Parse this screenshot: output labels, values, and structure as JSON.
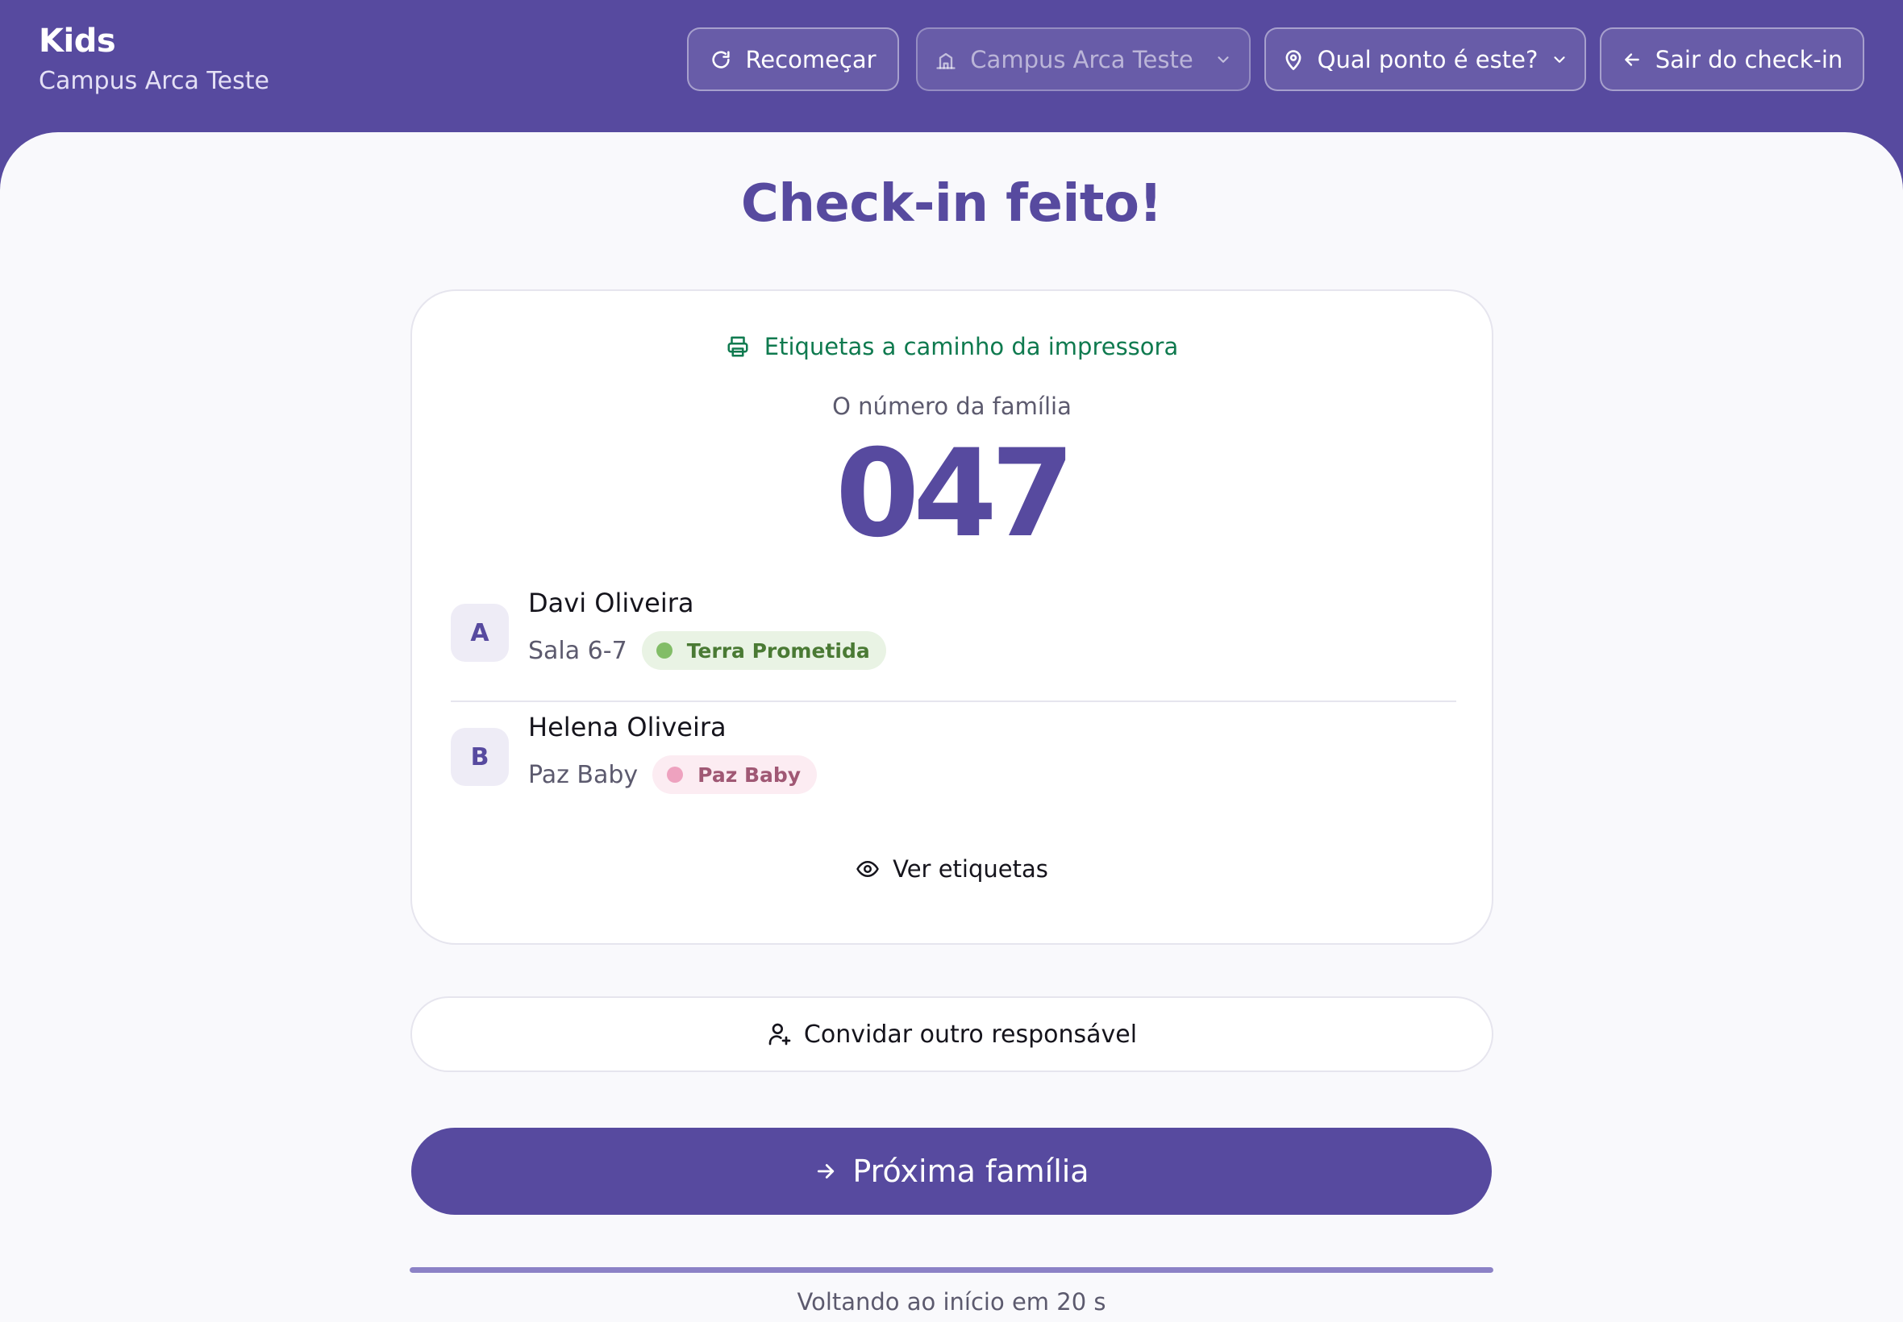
{
  "header": {
    "app_title": "Kids",
    "campus_subtitle": "Campus Arca Teste",
    "buttons": {
      "restart": {
        "label": "Recomeçar",
        "icon": "refresh-icon"
      },
      "campus": {
        "label": "Campus Arca Teste",
        "icon": "building-icon",
        "disabled": true
      },
      "point": {
        "label": "Qual ponto é este?",
        "icon": "map-pin-icon"
      },
      "exit": {
        "label": "Sair do check-in",
        "icon": "arrow-left-icon"
      }
    }
  },
  "main": {
    "title": "Check-in feito!",
    "card": {
      "printer_status": "Etiquetas a caminho da impressora",
      "family_number_label": "O número da família",
      "family_number": "047",
      "children": [
        {
          "letter": "A",
          "name": "Davi Oliveira",
          "room": "Sala 6-7",
          "group": "Terra Prometida",
          "group_color": "#82bd67"
        },
        {
          "letter": "B",
          "name": "Helena Oliveira",
          "room": "Paz Baby",
          "group": "Paz Baby",
          "group_color": "#eea2bf"
        }
      ],
      "view_labels": "Ver etiquetas"
    },
    "invite_button": "Convidar outro responsável",
    "next_button": "Próxima família",
    "countdown_text": "Voltando ao início em 20 s",
    "countdown_progress": 1.0
  },
  "colors": {
    "brand": "#574a9f",
    "success": "#0f7a4f",
    "background": "#f9f9fc"
  }
}
